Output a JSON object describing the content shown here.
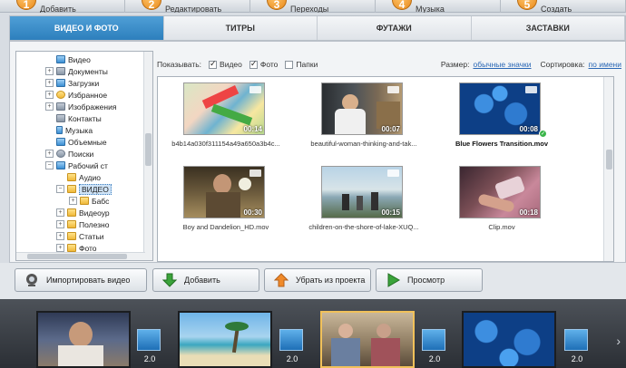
{
  "steps": [
    {
      "num": "1",
      "label": "Добавить"
    },
    {
      "num": "2",
      "label": "Редактировать"
    },
    {
      "num": "3",
      "label": "Переходы"
    },
    {
      "num": "4",
      "label": "Музыка"
    },
    {
      "num": "5",
      "label": "Создать"
    }
  ],
  "tabs": [
    {
      "label": "ВИДЕО И ФОТО",
      "active": true
    },
    {
      "label": "ТИТРЫ",
      "active": false
    },
    {
      "label": "ФУТАЖИ",
      "active": false
    },
    {
      "label": "ЗАСТАВКИ",
      "active": false
    }
  ],
  "tree": [
    {
      "label": "Видео",
      "icon": "video-folder-icon"
    },
    {
      "label": "Документы",
      "icon": "documents-folder-icon"
    },
    {
      "label": "Загрузки",
      "icon": "downloads-icon"
    },
    {
      "label": "Избранное",
      "icon": "star-icon"
    },
    {
      "label": "Изображения",
      "icon": "images-folder-icon"
    },
    {
      "label": "Контакты",
      "icon": "contacts-icon"
    },
    {
      "label": "Музыка",
      "icon": "music-icon"
    },
    {
      "label": "Объемные",
      "icon": "3d-objects-icon"
    },
    {
      "label": "Поиски",
      "icon": "search-icon"
    },
    {
      "label": "Рабочий ст",
      "icon": "desktop-icon"
    },
    {
      "label": "Аудио",
      "icon": "folder-icon"
    },
    {
      "label": "ВИДЕО",
      "icon": "folder-icon"
    },
    {
      "label": "Бабс",
      "icon": "folder-icon"
    },
    {
      "label": "Видеоур",
      "icon": "folder-icon"
    },
    {
      "label": "Полезно",
      "icon": "folder-icon"
    },
    {
      "label": "Статьи",
      "icon": "folder-icon"
    },
    {
      "label": "Фото",
      "icon": "folder-icon"
    }
  ],
  "filter": {
    "show_label": "Показывать:",
    "video_label": "Видео",
    "video_checked": true,
    "photo_label": "Фото",
    "photo_checked": true,
    "folders_label": "Папки",
    "folders_checked": false,
    "size_label": "Размер:",
    "size_value": "обычные значки",
    "sort_label": "Сортировка:",
    "sort_value": "по имени"
  },
  "files": [
    {
      "name": "b4b14a030f311154a49a650a3b4c...",
      "duration": "00:14",
      "bold": false,
      "checked": false
    },
    {
      "name": "beautiful-woman-thinking-and-tak...",
      "duration": "00:07",
      "bold": false,
      "checked": false
    },
    {
      "name": "Blue Flowers Transition.mov",
      "duration": "00:08",
      "bold": true,
      "checked": true
    },
    {
      "name": "Boy and Dandelion_HD.mov",
      "duration": "00:30",
      "bold": false,
      "checked": false
    },
    {
      "name": "children-on-the-shore-of-lake-XUQ...",
      "duration": "00:15",
      "bold": false,
      "checked": false
    },
    {
      "name": "Clip.mov",
      "duration": "00:18",
      "bold": false,
      "checked": false
    }
  ],
  "actions": {
    "import": "Импортировать видео",
    "add": "Добавить",
    "remove": "Убрать из проекта",
    "preview": "Просмотр"
  },
  "timeline": {
    "transitions": [
      "2.0",
      "2.0",
      "2.0",
      "2.0"
    ]
  },
  "colors": {
    "accent": "#2d7fbd",
    "step_badge": "#e8891a",
    "selected_clip_border": "#f1c15a"
  }
}
